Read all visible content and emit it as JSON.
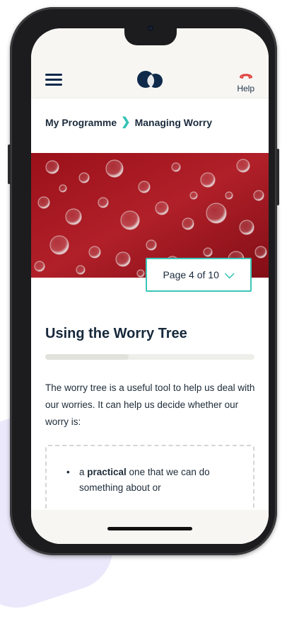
{
  "header": {
    "menu_icon": "hamburger-menu-icon",
    "logo_icon": "two-circle-logo-icon",
    "help_icon": "phone-hangup-icon",
    "help_label": "Help",
    "help_icon_color": "#e0413e"
  },
  "breadcrumb": {
    "parent": "My Programme",
    "separator_icon": "chevron-right-icon",
    "current": "Managing Worry"
  },
  "hero": {
    "image_icon": "red-bubbles-photo"
  },
  "pagination": {
    "label": "Page 4 of 10",
    "current_page": 4,
    "total_pages": 10,
    "chevron_icon": "chevron-down-icon"
  },
  "article": {
    "title": "Using the Worry Tree",
    "intro": "The worry tree is a useful tool to help us deal with our worries. It can help us decide whether our worry is:",
    "bullets": [
      {
        "prefix": "a ",
        "bold": "practical",
        "suffix": " one that we can do something about or"
      }
    ]
  },
  "colors": {
    "accent": "#3cc6b7",
    "navy": "#0f2a4a",
    "header_bg": "#f7f6f3"
  }
}
